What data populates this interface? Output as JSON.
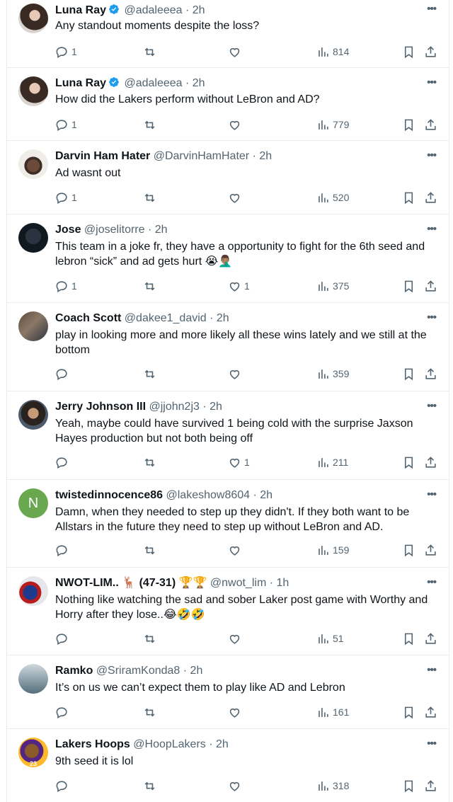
{
  "tweets": [
    {
      "name": "Luna Ray",
      "verified": true,
      "handle": "@adaleeea",
      "time": "2h",
      "text": "Any standout moments despite the loss?",
      "replies": "1",
      "retweets": "",
      "likes": "",
      "views": "814"
    },
    {
      "name": "Luna Ray",
      "verified": true,
      "handle": "@adaleeea",
      "time": "2h",
      "text": "How did the Lakers perform without LeBron and AD?",
      "replies": "1",
      "retweets": "",
      "likes": "",
      "views": "779"
    },
    {
      "name": "Darvin Ham Hater",
      "verified": false,
      "handle": "@DarvinHamHater",
      "time": "2h",
      "text": "Ad wasnt out",
      "replies": "1",
      "retweets": "",
      "likes": "",
      "views": "520"
    },
    {
      "name": "Jose",
      "verified": false,
      "handle": "@joselitorre",
      "time": "2h",
      "text": "This team in a joke fr, they have a opportunity to fight for the 6th seed and lebron “sick” and ad gets hurt 😭🤦🏽‍♂️",
      "replies": "1",
      "retweets": "",
      "likes": "1",
      "views": "375"
    },
    {
      "name": "Coach Scott",
      "verified": false,
      "handle": "@dakee1_david",
      "time": "2h",
      "text": "play in looking more and more likely all these wins lately and we still at the bottom",
      "replies": "",
      "retweets": "",
      "likes": "",
      "views": "359"
    },
    {
      "name": "Jerry Johnson III",
      "verified": false,
      "handle": "@jjohn2j3",
      "time": "2h",
      "text": "Yeah, maybe could have survived 1 being cold with the surprise Jaxson Hayes production but not both being off",
      "replies": "",
      "retweets": "",
      "likes": "1",
      "views": "211"
    },
    {
      "name": "twistedinnocence86",
      "verified": false,
      "handle": "@lakeshow8604",
      "time": "2h",
      "text": "Damn, when they needed to step up they didn't. If they both want to be Allstars in the future they need to step up without LeBron and AD.",
      "replies": "",
      "retweets": "",
      "likes": "",
      "views": "159",
      "avatar_letter": "N"
    },
    {
      "name": "NWOT-LIM.. 🦌 (47-31) 🏆🏆",
      "verified": false,
      "handle": "@nwot_lim",
      "time": "1h",
      "text": "Nothing like watching the sad and sober Laker post game with Worthy and Horry after they lose..😂🤣🤣",
      "replies": "",
      "retweets": "",
      "likes": "",
      "views": "51"
    },
    {
      "name": "Ramko",
      "verified": false,
      "handle": "@SriramKonda8",
      "time": "2h",
      "text": "It’s on us we can’t expect them to play like AD and Lebron",
      "replies": "",
      "retweets": "",
      "likes": "",
      "views": "161"
    },
    {
      "name": "Lakers Hoops",
      "verified": false,
      "handle": "@HoopLakers",
      "time": "2h",
      "text": "9th seed it is lol",
      "replies": "",
      "retweets": "",
      "likes": "",
      "views": "318",
      "avatar_letter": "23"
    }
  ],
  "colors": {
    "verified": "#1d9bf0",
    "secondary": "#536471",
    "border": "#e6ecf0"
  },
  "icons": {
    "reply": "reply-icon",
    "retweet": "retweet-icon",
    "like": "heart-icon",
    "views": "views-icon",
    "bookmark": "bookmark-icon",
    "share": "share-icon",
    "more": "more-icon",
    "verified": "verified-badge-icon"
  }
}
